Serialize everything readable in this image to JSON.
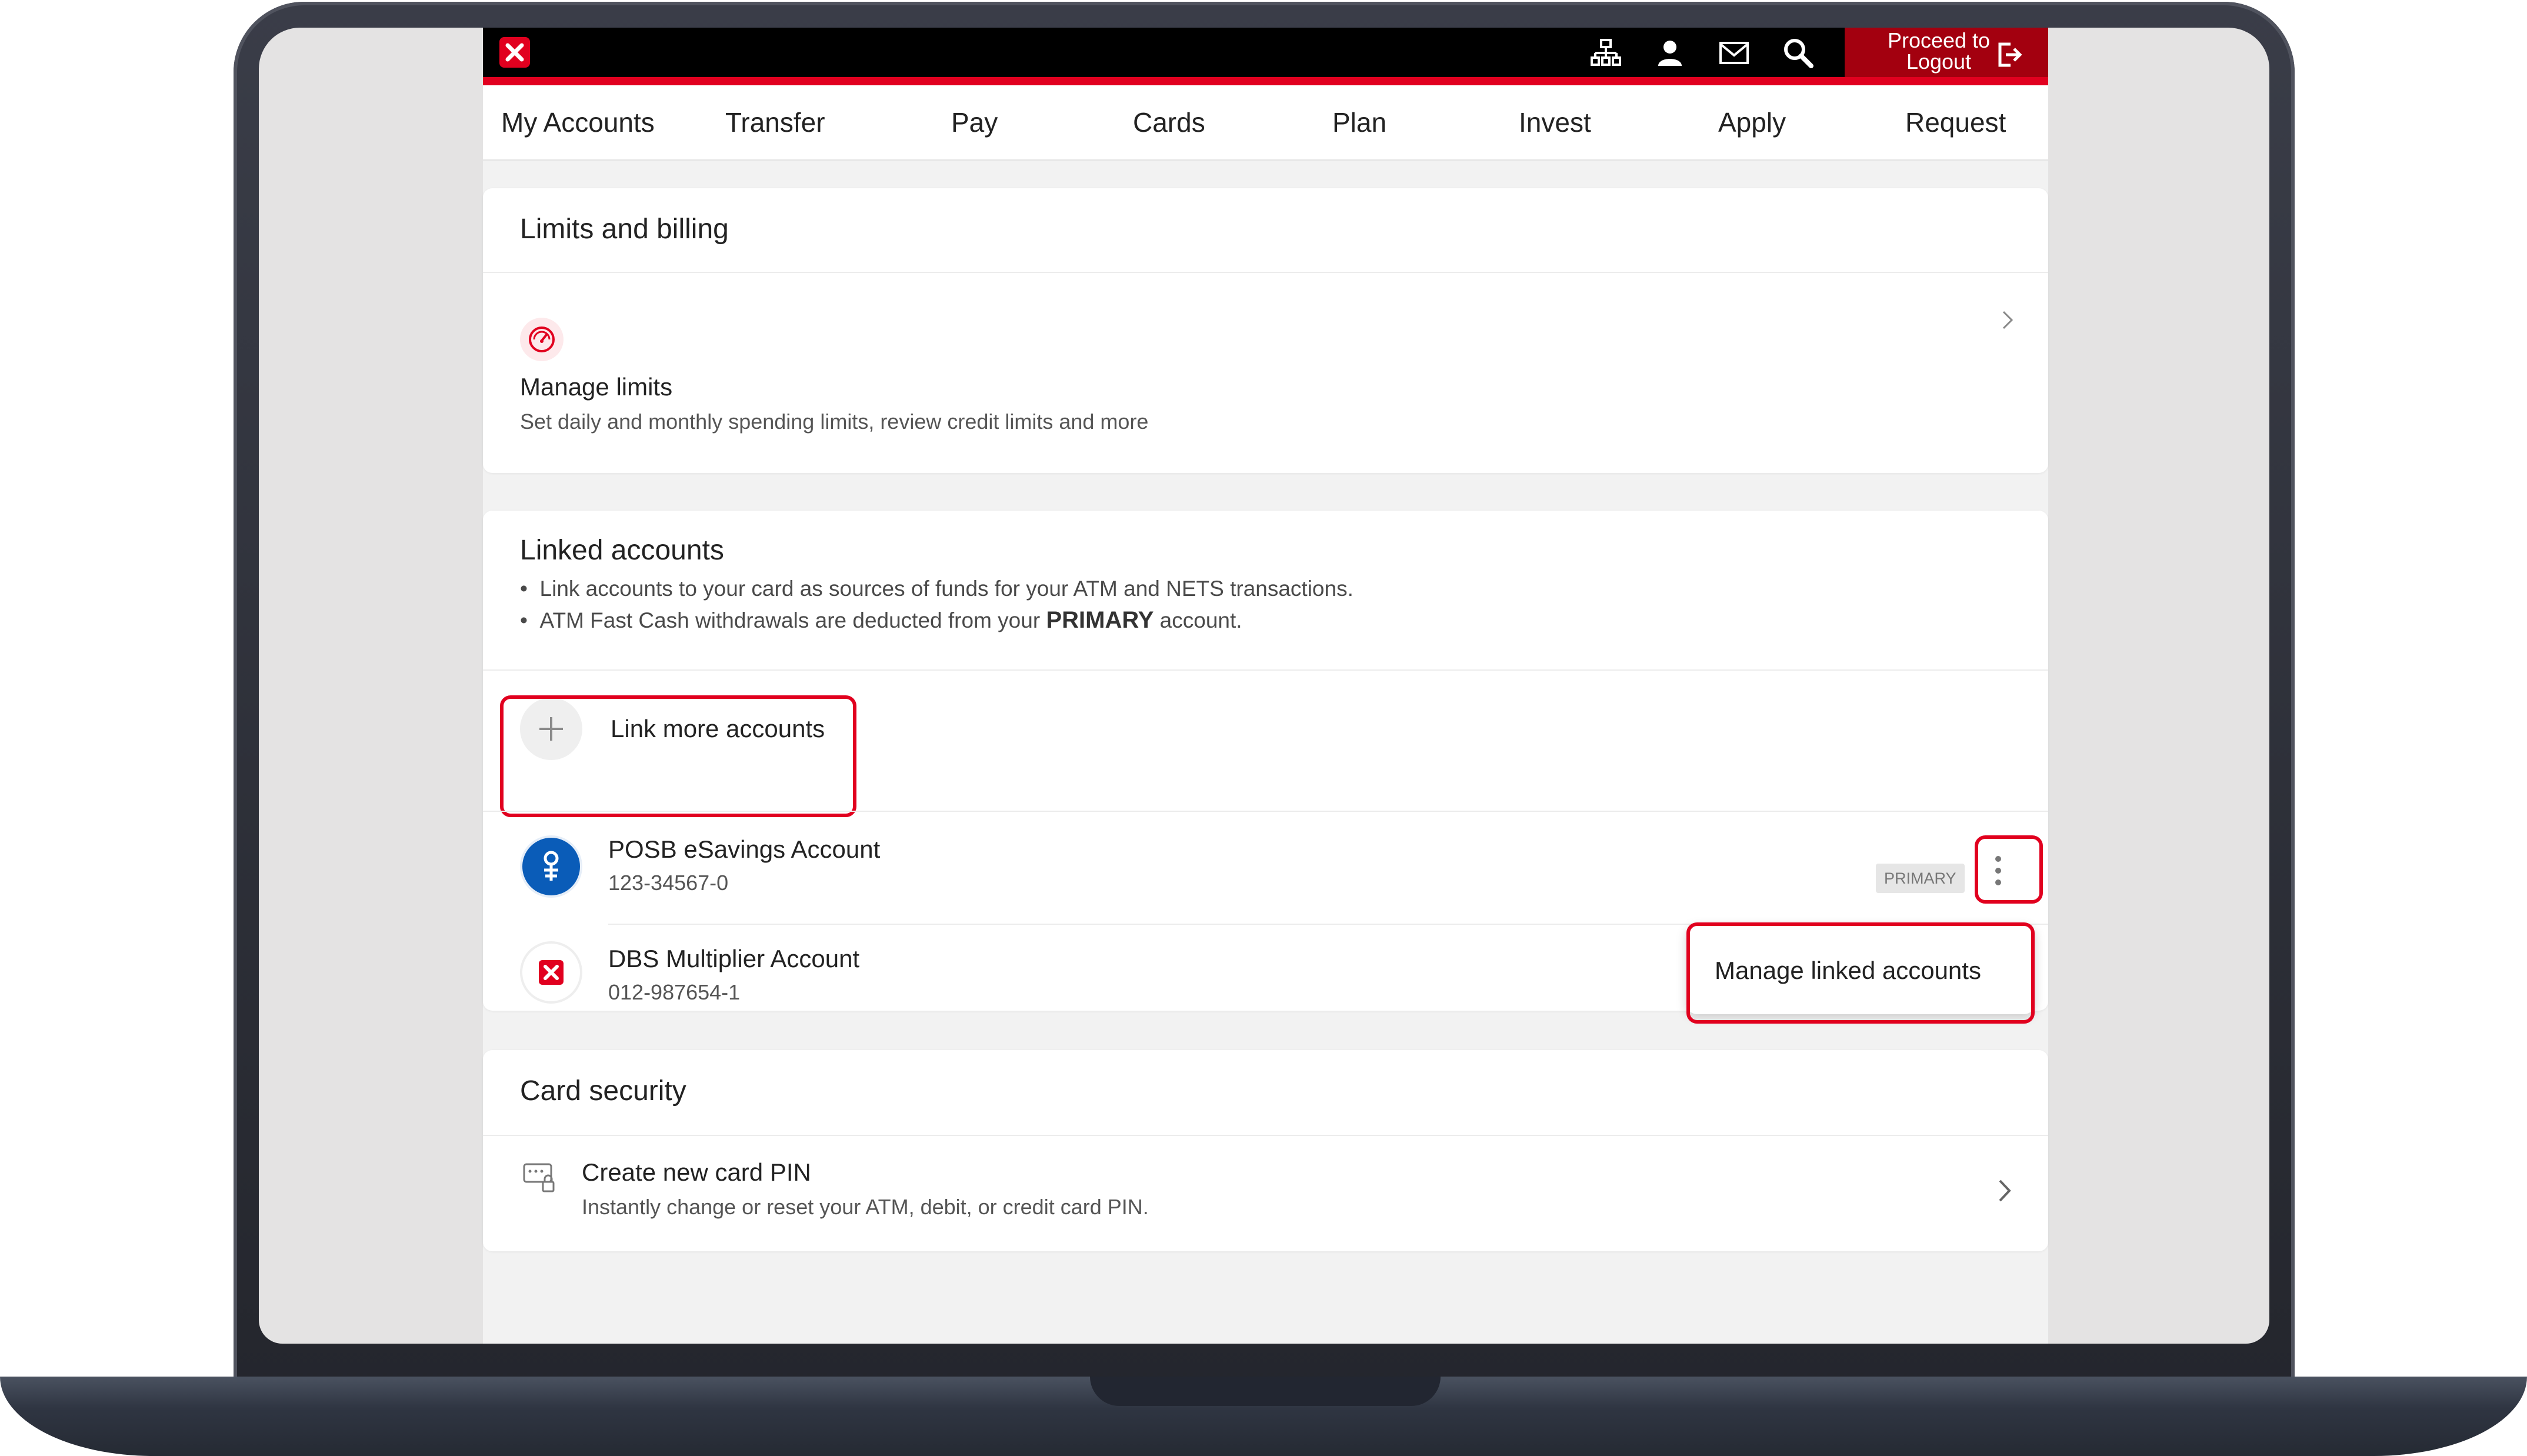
{
  "header": {
    "logout_line1": "Proceed to",
    "logout_line2": "Logout",
    "icons": [
      "sitemap-icon",
      "profile-icon",
      "mail-icon",
      "search-icon",
      "logout-icon"
    ]
  },
  "nav": {
    "tabs": [
      "My Accounts",
      "Transfer",
      "Pay",
      "Cards",
      "Plan",
      "Invest",
      "Apply",
      "Request"
    ]
  },
  "limits": {
    "title": "Limits and billing",
    "item_title": "Manage limits",
    "item_desc": "Set daily and monthly spending limits, review credit limits and more"
  },
  "linked": {
    "title": "Linked accounts",
    "bullet1": "Link accounts to your card as sources of funds for your ATM and NETS transactions.",
    "bullet2_pre": "ATM Fast Cash withdrawals are deducted from your ",
    "bullet2_bold": "PRIMARY",
    "bullet2_post": " account.",
    "link_more": "Link more accounts",
    "accounts": [
      {
        "name": "POSB eSavings Account",
        "number": "123-34567-0",
        "badge": "PRIMARY"
      },
      {
        "name": "DBS Multiplier Account",
        "number": "012-987654-1"
      }
    ],
    "menu_item": "Manage linked accounts"
  },
  "security": {
    "title": "Card security",
    "item_title": "Create new card PIN",
    "item_desc": "Instantly change or reset your ATM, debit, or credit card PIN."
  },
  "colors": {
    "brand_red": "#e1001f",
    "logout_bg": "#a3000f",
    "posb_blue": "#0a5cb8"
  }
}
